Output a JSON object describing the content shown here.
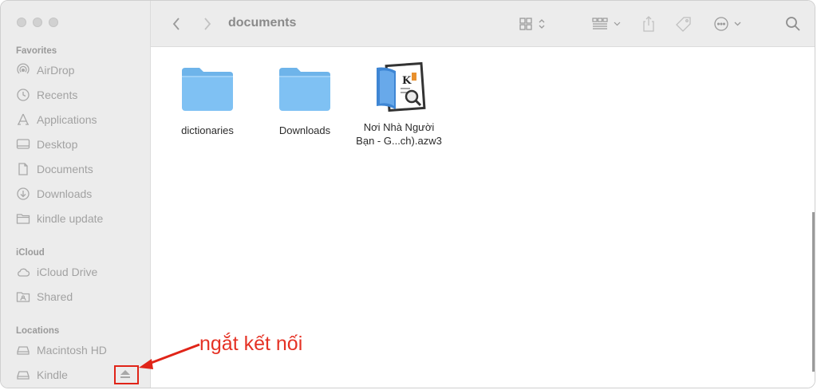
{
  "window": {
    "title": "documents"
  },
  "sidebar": {
    "sections": [
      {
        "title": "Favorites"
      },
      {
        "title": "iCloud"
      },
      {
        "title": "Locations"
      }
    ],
    "favorites": [
      {
        "label": "AirDrop",
        "icon": "airdrop-icon"
      },
      {
        "label": "Recents",
        "icon": "clock-icon"
      },
      {
        "label": "Applications",
        "icon": "applications-icon"
      },
      {
        "label": "Desktop",
        "icon": "desktop-icon"
      },
      {
        "label": "Documents",
        "icon": "document-icon"
      },
      {
        "label": "Downloads",
        "icon": "download-icon"
      },
      {
        "label": "kindle update",
        "icon": "folder-icon"
      }
    ],
    "icloud": [
      {
        "label": "iCloud Drive",
        "icon": "cloud-icon"
      },
      {
        "label": "Shared",
        "icon": "shared-folder-icon"
      }
    ],
    "locations": [
      {
        "label": "Macintosh HD",
        "icon": "disk-icon"
      },
      {
        "label": "Kindle",
        "icon": "disk-icon"
      }
    ]
  },
  "files": [
    {
      "name": "dictionaries",
      "kind": "folder"
    },
    {
      "name": "Downloads",
      "kind": "folder"
    },
    {
      "name_line1": "Nơi Nhà Người",
      "name_line2": "Bạn - G...ch).azw3",
      "kind": "kindle-book"
    }
  ],
  "annotation": {
    "text": "ngắt kết nối",
    "color": "#e53225"
  }
}
